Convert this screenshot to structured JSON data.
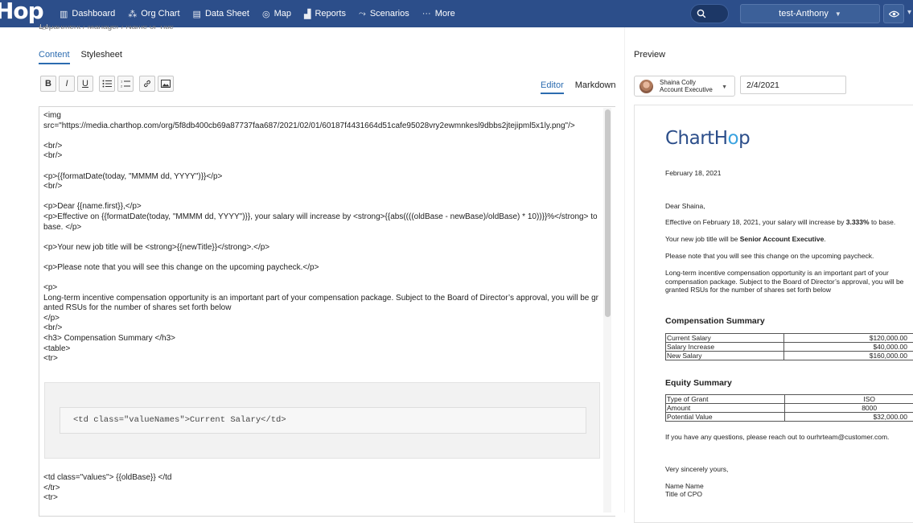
{
  "brand": {
    "logo_text": "Hop",
    "nav_color": "#2c4e8a"
  },
  "nav": {
    "items": [
      {
        "label": "Dashboard",
        "icon": "bar-chart-icon"
      },
      {
        "label": "Org Chart",
        "icon": "org-chart-icon"
      },
      {
        "label": "Data Sheet",
        "icon": "table-icon"
      },
      {
        "label": "Map",
        "icon": "globe-icon"
      },
      {
        "label": "Reports",
        "icon": "reports-icon"
      },
      {
        "label": "Scenarios",
        "icon": "scenarios-icon"
      },
      {
        "label": "More",
        "icon": "more-dots-icon"
      }
    ],
    "user_selector": "test-Anthony"
  },
  "partial_line": "Department / Manager / Name or Title",
  "content_tabs": [
    "Content",
    "Stylesheet"
  ],
  "toolbar": [
    "B",
    "I",
    "U",
    "bullet-list",
    "numbered-list",
    "link",
    "image"
  ],
  "editor_modes": [
    "Editor",
    "Markdown"
  ],
  "editor": {
    "lines": [
      "<img",
      "src=\"https://media.charthop.com/org/5f8db400cb69a87737faa687/2021/02/01/60187f4431664d51cafe95028vry2ewmnkesl9dbbs2jtejipml5x1ly.png\"/>",
      "",
      "<br/>",
      "<br/>",
      "",
      "<p>{{formatDate(today, \"MMMM dd, YYYY\")}}</p>",
      "<br/>",
      "",
      "<p>Dear {{name.first}},</p>",
      "<p>Effective on {{formatDate(today, \"MMMM dd, YYYY\")}}, your salary will increase by <strong>{{abs((((oldBase - newBase)/oldBase) * 10))}}%</strong> to base. </p>",
      "",
      "<p>Your new job title will be <strong>{{newTitle}}</strong>.</p>",
      "",
      "<p>Please note that you will see this change on the upcoming paycheck.</p>",
      "",
      "<p>",
      "Long-term incentive compensation opportunity is an important part of your compensation package. Subject to the Board of Director’s approval, you will be granted RSUs for the number of shares set forth below",
      "</p>",
      "<br/>",
      "<h3> Compensation Summary </h3>",
      "<table>",
      "<tr>"
    ],
    "code_block": "<td class=\"valueNames\">Current Salary</td>",
    "after_block": [
      "<td class=\"values\"> {{oldBase}} </td",
      "</tr>",
      "<tr>"
    ]
  },
  "preview": {
    "title": "Preview",
    "person_name": "Shaina Colly",
    "person_title": "Account Executive",
    "date": "2/4/2021",
    "logo": {
      "part1": "ChartH",
      "part2": "o",
      "part3": "p"
    },
    "letter_date": "February 18, 2021",
    "greeting": "Dear Shaina,",
    "effective_pre": "Effective on February 18, 2021, your salary will increase by ",
    "effective_pct": "3.333%",
    "effective_post": " to base.",
    "title_pre": "Your new job title will be ",
    "title_bold": "Senior Account Executive",
    "title_post": ".",
    "note": "Please note that you will see this change on the upcoming paycheck.",
    "lti": "Long-term incentive compensation opportunity is an important part of your compensation package. Subject to the Board of Director’s approval, you will be granted RSUs for the number of shares set forth below",
    "comp_heading": "Compensation Summary",
    "comp_rows": [
      [
        "Current Salary",
        "$120,000.00"
      ],
      [
        "Salary Increase",
        "$40,000.00"
      ],
      [
        "New Salary",
        "$160,000.00"
      ]
    ],
    "equity_heading": "Equity Summary",
    "equity_rows": [
      [
        "Type of Grant",
        "ISO"
      ],
      [
        "Amount",
        "8000"
      ],
      [
        "Potential Value",
        "$32,000.00"
      ]
    ],
    "questions": "If you have any questions, please reach out to ourhrteam@customer.com.",
    "closing": "Very sincerely yours,",
    "sign_name": "Name Name",
    "sign_title": "Title of CPO"
  }
}
